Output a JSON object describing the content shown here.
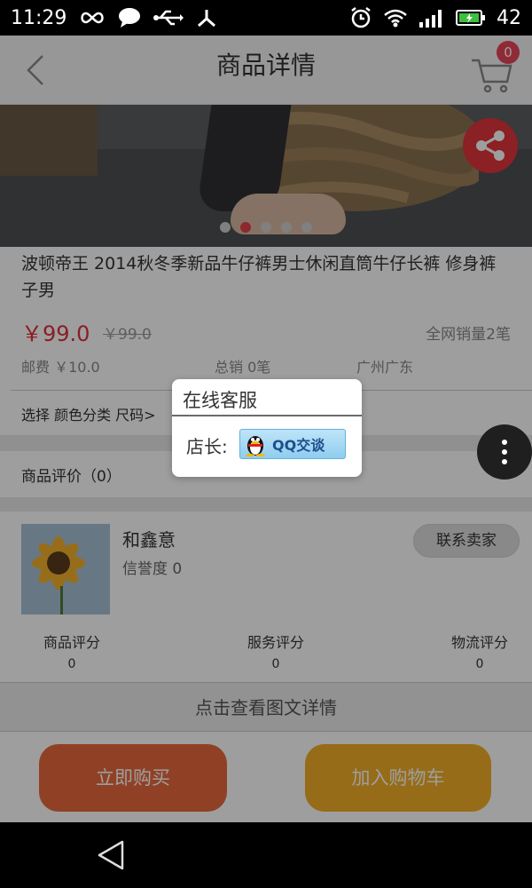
{
  "status_bar": {
    "time": "11:29",
    "battery_level": "42"
  },
  "header": {
    "title": "商品详情",
    "cart_count": "0"
  },
  "carousel": {
    "slide_count": 5,
    "active_index": 1
  },
  "product": {
    "title": "波顿帝王 2014秋冬季新品牛仔裤男士休闲直筒牛仔长裤 修身裤子男",
    "price": "￥99.0",
    "original_price": "￥99.0",
    "total_network_sales": "全网销量2笔",
    "shipping": "邮费 ￥10.0",
    "total_sales": "总销 0笔",
    "location": "广州广东",
    "select_option": "选择 颜色分类 尺码>",
    "reviews": "商品评价（0）"
  },
  "seller": {
    "name": "和鑫意",
    "credit": "信誉度 0",
    "contact_label": "联系卖家",
    "scores": [
      {
        "label": "商品评分",
        "value": "0"
      },
      {
        "label": "服务评分",
        "value": "0"
      },
      {
        "label": "物流评分",
        "value": "0"
      }
    ]
  },
  "detail_link": "点击查看图文详情",
  "actions": {
    "buy_now": "立即购买",
    "add_to_cart": "加入购物车"
  },
  "dialog": {
    "title": "在线客服",
    "owner_label": "店长:",
    "qq_label": "QQ交谈"
  },
  "colors": {
    "price_red": "#e0303a",
    "buy_orange": "#e96a3d",
    "cart_yellow": "#f2ae27",
    "share_red": "#e1343c"
  },
  "icons": [
    "back-arrow-icon",
    "cart-icon",
    "share-icon",
    "more-icon",
    "qq-penguin-icon",
    "nav-back-icon"
  ]
}
